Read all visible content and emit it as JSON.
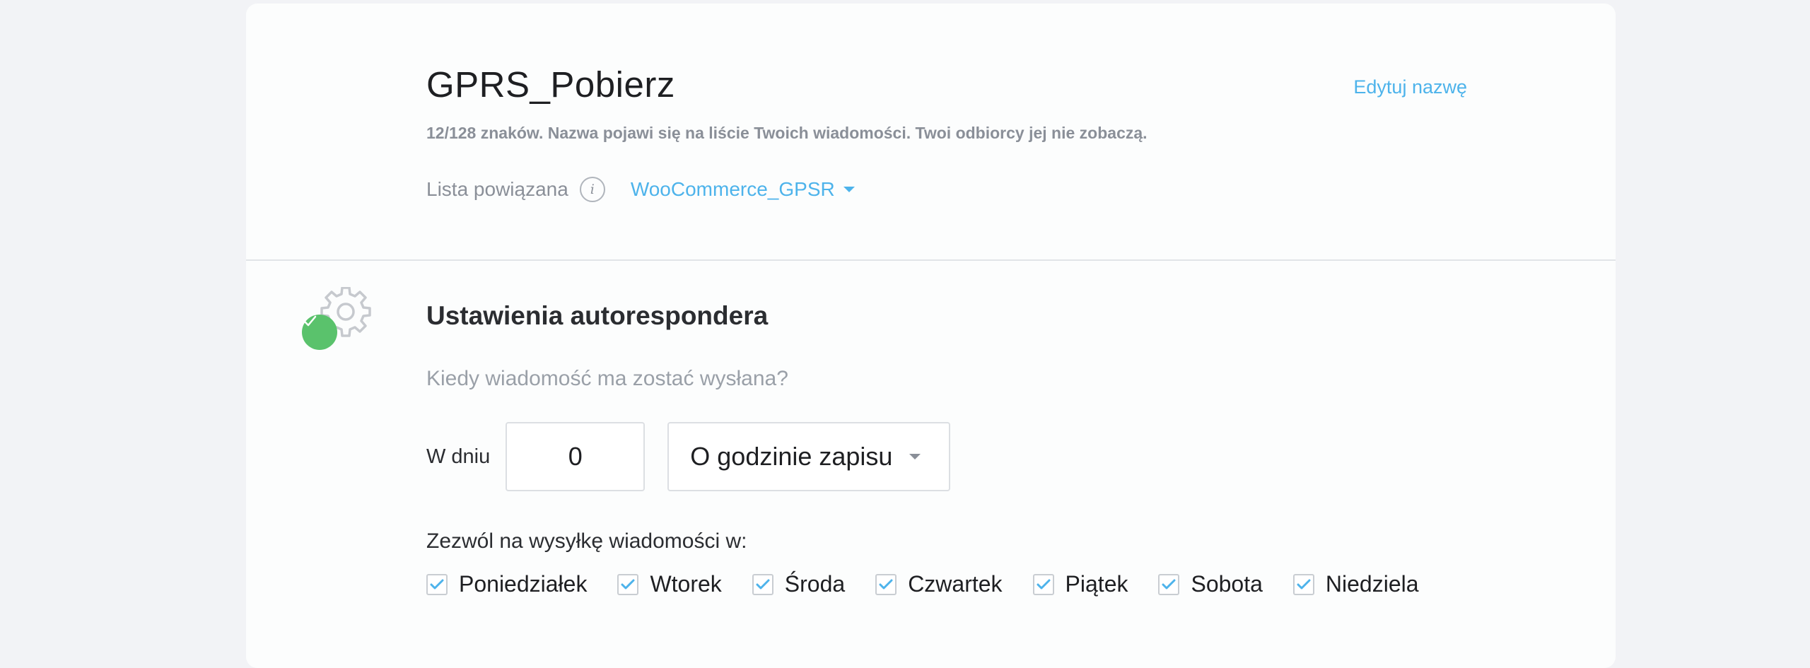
{
  "header": {
    "title": "GPRS_Pobierz",
    "edit_link": "Edytuj nazwę",
    "char_info": "12/128 znaków. Nazwa pojawi się na liście Twoich wiadomości. Twoi odbiorcy jej nie zobaczą.",
    "list_label": "Lista powiązana",
    "info_icon": "i",
    "list_value": "WooCommerce_GPSR"
  },
  "settings": {
    "title": "Ustawienia autorespondera",
    "question": "Kiedy wiadomość ma zostać wysłana?",
    "day_label": "W dniu",
    "day_value": "0",
    "time_option": "O godzinie zapisu",
    "allow_label": "Zezwól na wysyłkę wiadomości w:",
    "weekdays": [
      {
        "label": "Poniedziałek",
        "checked": true
      },
      {
        "label": "Wtorek",
        "checked": true
      },
      {
        "label": "Środa",
        "checked": true
      },
      {
        "label": "Czwartek",
        "checked": true
      },
      {
        "label": "Piątek",
        "checked": true
      },
      {
        "label": "Sobota",
        "checked": true
      },
      {
        "label": "Niedziela",
        "checked": true
      }
    ]
  },
  "icons": {
    "section": "gear-icon",
    "status": "check-icon",
    "dropdown": "caret-down-icon"
  },
  "colors": {
    "accent": "#4db3eb",
    "success": "#5ac26c",
    "background": "#f2f3f6",
    "card": "#fcfdfd"
  }
}
